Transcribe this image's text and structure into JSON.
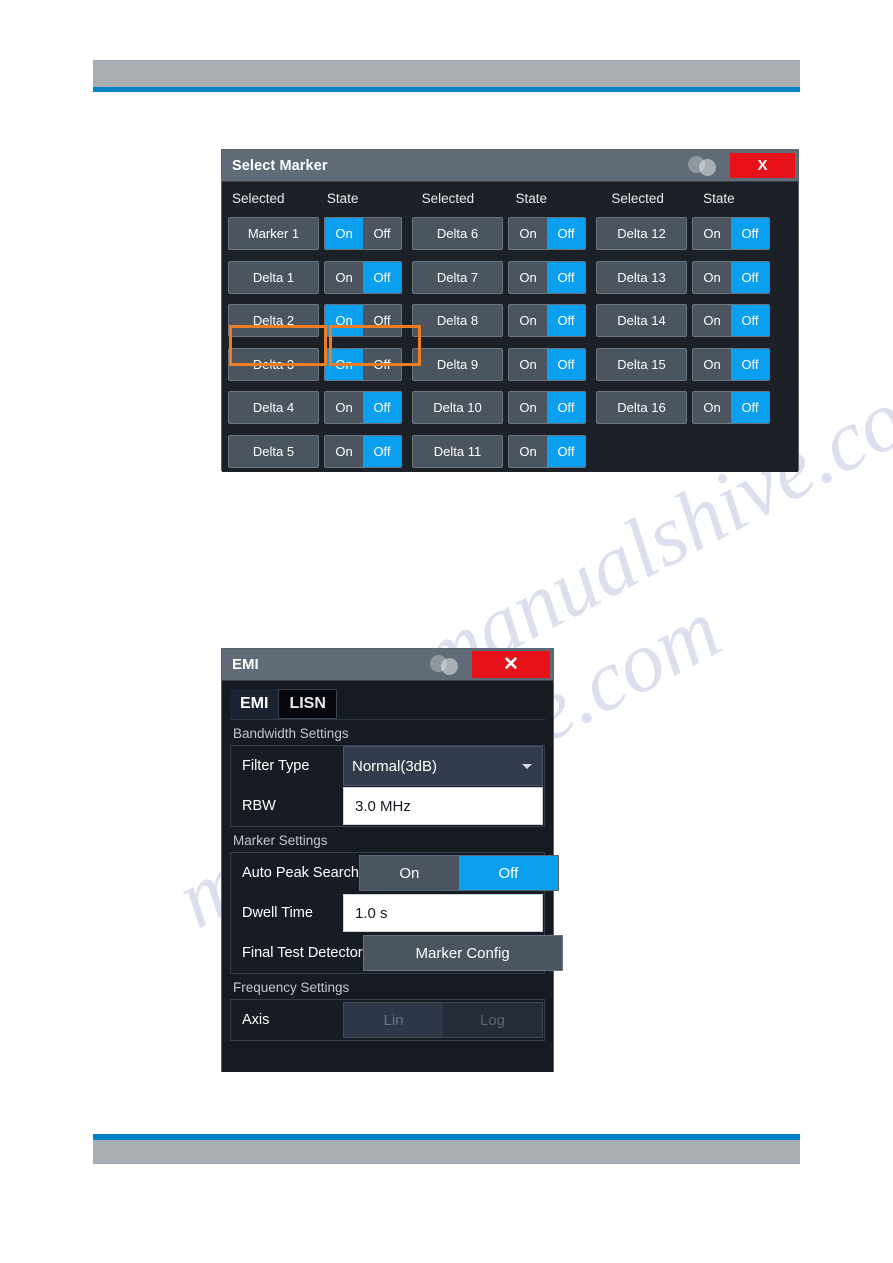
{
  "marker_dialog": {
    "title": "Select Marker",
    "close_label": "X",
    "headers": [
      "Selected",
      "State",
      "Selected",
      "State",
      "Selected",
      "State"
    ],
    "on_label": "On",
    "off_label": "Off",
    "focus_row_index": 2,
    "accent_focus_color": "#f07c21",
    "accent_active_color": "#0b9ff0",
    "columns": [
      {
        "header_selected": "Selected",
        "header_state": "State",
        "rows": [
          {
            "label": "Marker 1",
            "state": "On"
          },
          {
            "label": "Delta 1",
            "state": "Off"
          },
          {
            "label": "Delta 2",
            "state": "On"
          },
          {
            "label": "Delta 3",
            "state": "On"
          },
          {
            "label": "Delta 4",
            "state": "Off"
          },
          {
            "label": "Delta 5",
            "state": "Off"
          }
        ]
      },
      {
        "header_selected": "Selected",
        "header_state": "State",
        "rows": [
          {
            "label": "Delta 6",
            "state": "Off"
          },
          {
            "label": "Delta 7",
            "state": "Off"
          },
          {
            "label": "Delta 8",
            "state": "Off"
          },
          {
            "label": "Delta 9",
            "state": "Off"
          },
          {
            "label": "Delta 10",
            "state": "Off"
          },
          {
            "label": "Delta 11",
            "state": "Off"
          }
        ]
      },
      {
        "header_selected": "Selected",
        "header_state": "State",
        "rows": [
          {
            "label": "Delta 12",
            "state": "Off"
          },
          {
            "label": "Delta 13",
            "state": "Off"
          },
          {
            "label": "Delta 14",
            "state": "Off"
          },
          {
            "label": "Delta 15",
            "state": "Off"
          },
          {
            "label": "Delta 16",
            "state": "Off"
          }
        ]
      }
    ]
  },
  "emi_dialog": {
    "title": "EMI",
    "close_label": "✕",
    "tabs": [
      {
        "label": "EMI",
        "active": true
      },
      {
        "label": "LISN",
        "active": false
      }
    ],
    "groups": [
      {
        "label": "Bandwidth Settings",
        "rows": [
          {
            "label": "Filter Type",
            "value": "Normal(3dB)",
            "type": "dropdown"
          },
          {
            "label": "RBW",
            "value": "3.0 MHz",
            "type": "textfield"
          }
        ]
      },
      {
        "label": "Marker Settings",
        "rows": [
          {
            "label": "Auto Peak Search",
            "value": "Off",
            "type": "toggle",
            "on_label": "On",
            "off_label": "Off"
          },
          {
            "label": "Dwell Time",
            "value": "1.0 s",
            "type": "textfield"
          },
          {
            "label": "Final Test Detector",
            "value": "Marker Config",
            "type": "button"
          }
        ]
      },
      {
        "label": "Frequency Settings",
        "rows": [
          {
            "label": "Axis",
            "value": "Lin",
            "type": "toggle-disabled",
            "on_label": "Lin",
            "off_label": "Log"
          }
        ]
      }
    ]
  },
  "watermark": {
    "line1": "manualshive.com",
    "line2": "manualshive.com"
  }
}
